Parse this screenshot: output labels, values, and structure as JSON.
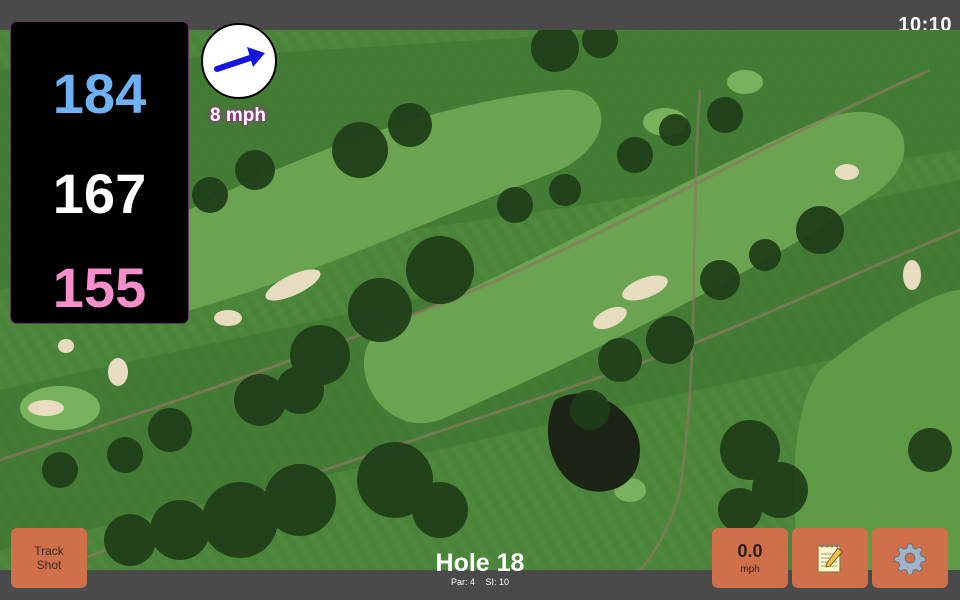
{
  "status": {
    "time": "10:10"
  },
  "distances": {
    "back": "184",
    "center": "167",
    "front": "155"
  },
  "wind": {
    "speed": "8 mph",
    "direction_icon": "arrow-up-right-icon"
  },
  "hole": {
    "title": "Hole 18",
    "par": "Par: 4",
    "stroke_index": "SI: 10"
  },
  "buttons": {
    "track_shot": "Track\nShot",
    "speed_value": "0.0",
    "speed_unit": "mph",
    "notes_icon": "notepad-icon",
    "settings_icon": "gear-icon"
  },
  "colors": {
    "back": "#6fb1f5",
    "center": "#ffffff",
    "front": "#f58ecb",
    "button": "#d0704a",
    "bar": "#4a4a4a"
  }
}
